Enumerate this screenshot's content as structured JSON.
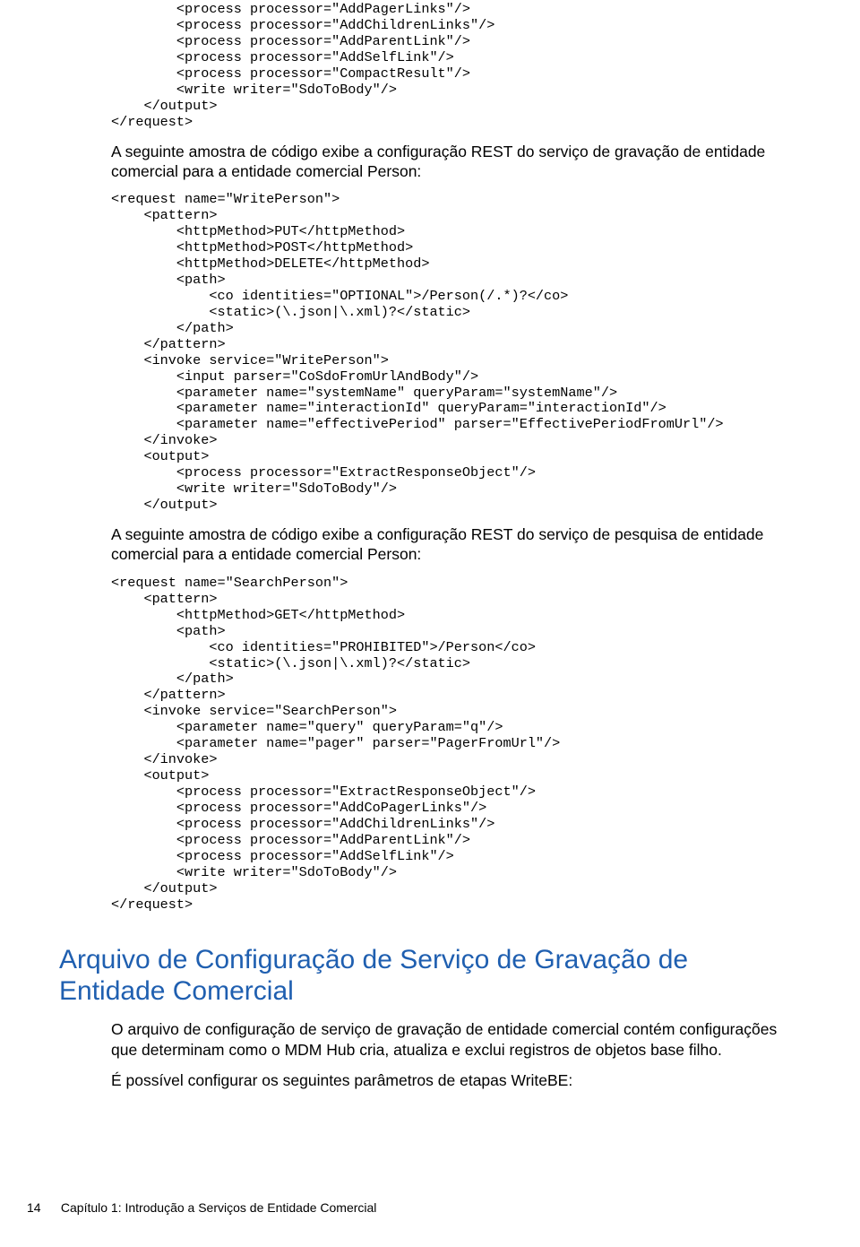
{
  "code_block_top": "        <process processor=\"AddPagerLinks\"/>\n        <process processor=\"AddChildrenLinks\"/>\n        <process processor=\"AddParentLink\"/>\n        <process processor=\"AddSelfLink\"/>\n        <process processor=\"CompactResult\"/>\n        <write writer=\"SdoToBody\"/>\n    </output>\n</request>",
  "para1": "A seguinte amostra de código exibe a configuração REST do serviço de gravação de entidade comercial para a entidade comercial Person:",
  "code_block_mid": "<request name=\"WritePerson\">\n    <pattern>\n        <httpMethod>PUT</httpMethod>\n        <httpMethod>POST</httpMethod>\n        <httpMethod>DELETE</httpMethod>\n        <path>\n            <co identities=\"OPTIONAL\">/Person(/.*)?</co>\n            <static>(\\.json|\\.xml)?</static>\n        </path>\n    </pattern>\n    <invoke service=\"WritePerson\">\n        <input parser=\"CoSdoFromUrlAndBody\"/>\n        <parameter name=\"systemName\" queryParam=\"systemName\"/>\n        <parameter name=\"interactionId\" queryParam=\"interactionId\"/>\n        <parameter name=\"effectivePeriod\" parser=\"EffectivePeriodFromUrl\"/>\n    </invoke>\n    <output>\n        <process processor=\"ExtractResponseObject\"/>\n        <write writer=\"SdoToBody\"/>\n    </output>",
  "para2": "A seguinte amostra de código exibe a configuração REST do serviço de pesquisa de entidade comercial para a entidade comercial Person:",
  "code_block_bot": "<request name=\"SearchPerson\">\n    <pattern>\n        <httpMethod>GET</httpMethod>\n        <path>\n            <co identities=\"PROHIBITED\">/Person</co>\n            <static>(\\.json|\\.xml)?</static>\n        </path>\n    </pattern>\n    <invoke service=\"SearchPerson\">\n        <parameter name=\"query\" queryParam=\"q\"/>\n        <parameter name=\"pager\" parser=\"PagerFromUrl\"/>\n    </invoke>\n    <output>\n        <process processor=\"ExtractResponseObject\"/>\n        <process processor=\"AddCoPagerLinks\"/>\n        <process processor=\"AddChildrenLinks\"/>\n        <process processor=\"AddParentLink\"/>\n        <process processor=\"AddSelfLink\"/>\n        <write writer=\"SdoToBody\"/>\n    </output>\n</request>",
  "heading": "Arquivo de Configuração de Serviço de Gravação de Entidade Comercial",
  "para3": "O arquivo de configuração de serviço de gravação de entidade comercial contém configurações que determinam como o MDM Hub cria, atualiza e exclui registros de objetos base filho.",
  "para4": "É possível configurar os seguintes parâmetros de etapas WriteBE:",
  "footer_page": "14",
  "footer_chapter": "Capítulo 1: Introdução a Serviços de Entidade Comercial"
}
